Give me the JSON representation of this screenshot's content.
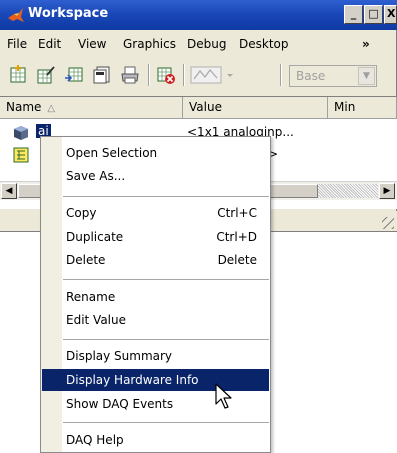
{
  "window": {
    "title": "Workspace",
    "controls": {
      "minimize": "_",
      "maximize": "□",
      "close": "X"
    }
  },
  "menubar": {
    "items": [
      "File",
      "Edit",
      "View",
      "Graphics",
      "Debug",
      "Desktop"
    ],
    "more": "»"
  },
  "toolbar": {
    "icons": [
      "new-variable-icon",
      "open-variable-icon",
      "import-data-icon",
      "save-icon",
      "print-icon",
      "delete-icon",
      "plot-icon"
    ],
    "stack_select": {
      "value": "Base",
      "dropdown": "▼"
    }
  },
  "grid": {
    "columns": {
      "name": "Name",
      "name_sort": "△",
      "value": "Value",
      "min": "Min"
    },
    "rows": [
      {
        "icon": "analog-input-object-icon",
        "name": "ai",
        "value": "<1x1 analoginp..."
      },
      {
        "icon": "struct-icon",
        "name": "",
        "value": ">"
      }
    ],
    "scroll": {
      "left": "◀",
      "right": "▶"
    }
  },
  "context_menu": {
    "groups": [
      [
        {
          "label": "Open Selection",
          "shortcut": ""
        },
        {
          "label": "Save As...",
          "shortcut": ""
        }
      ],
      [
        {
          "label": "Copy",
          "shortcut": "Ctrl+C"
        },
        {
          "label": "Duplicate",
          "shortcut": "Ctrl+D"
        },
        {
          "label": "Delete",
          "shortcut": "Delete"
        }
      ],
      [
        {
          "label": "Rename",
          "shortcut": ""
        },
        {
          "label": "Edit Value",
          "shortcut": ""
        }
      ],
      [
        {
          "label": "Display Summary",
          "shortcut": ""
        },
        {
          "label": "Display Hardware Info",
          "shortcut": ""
        },
        {
          "label": "Show DAQ Events",
          "shortcut": ""
        }
      ],
      [
        {
          "label": "DAQ Help",
          "shortcut": ""
        }
      ]
    ],
    "highlighted": "Display Hardware Info"
  },
  "colors": {
    "titlebar": "#1a48b8",
    "selection": "#0a246a",
    "chrome": "#ece9d8"
  }
}
